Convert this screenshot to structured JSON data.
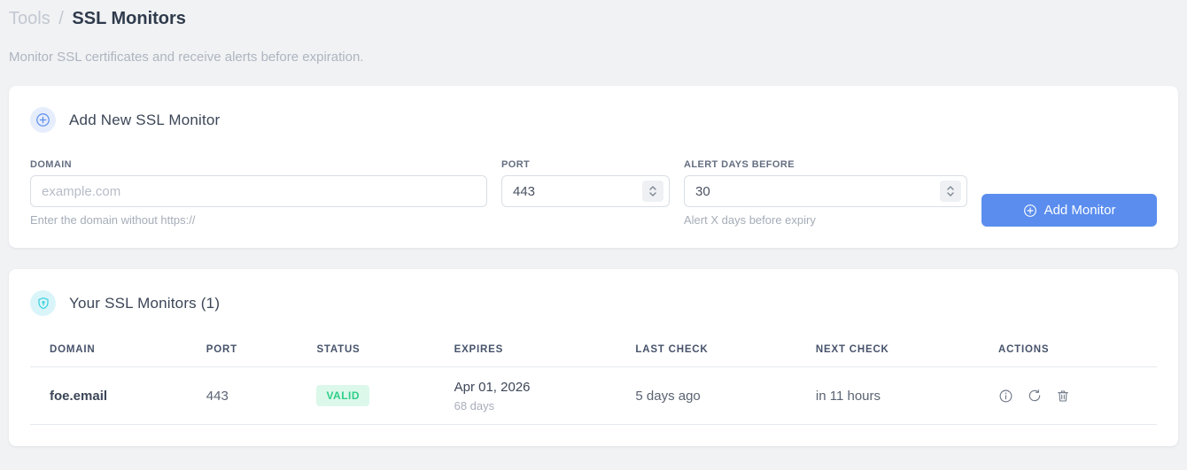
{
  "breadcrumb": {
    "section": "Tools",
    "separator": "/",
    "current": "SSL Monitors"
  },
  "subtitle": "Monitor SSL certificates and receive alerts before expiration.",
  "add_monitor_card": {
    "title": "Add New SSL Monitor",
    "fields": {
      "domain": {
        "label": "DOMAIN",
        "placeholder": "example.com",
        "value": "",
        "helper": "Enter the domain without https://"
      },
      "port": {
        "label": "PORT",
        "value": "443"
      },
      "alert_days": {
        "label": "ALERT DAYS BEFORE",
        "value": "30",
        "helper": "Alert X days before expiry"
      }
    },
    "submit_label": "Add Monitor"
  },
  "monitors_card": {
    "title": "Your SSL Monitors (1)",
    "table": {
      "headers": [
        "DOMAIN",
        "PORT",
        "STATUS",
        "EXPIRES",
        "LAST CHECK",
        "NEXT CHECK",
        "ACTIONS"
      ],
      "rows": [
        {
          "domain": "foe.email",
          "port": "443",
          "status": "VALID",
          "expires_date": "Apr 01, 2026",
          "expires_in": "68 days",
          "last_check": "5 days ago",
          "next_check": "in 11 hours"
        }
      ]
    }
  },
  "colors": {
    "accent_blue": "#5a8dee",
    "icon_cyan": "#35cfdd",
    "badge_green_bg": "#dcf8ea",
    "badge_green_text": "#2ece89",
    "page_bg": "#f1f2f4"
  }
}
